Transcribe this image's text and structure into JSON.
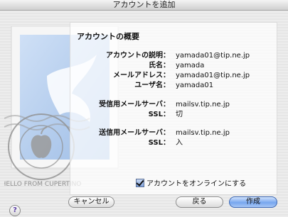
{
  "window": {
    "title": "アカウントを追加"
  },
  "summary": {
    "title": "アカウントの概要",
    "rows": [
      {
        "label": "アカウントの説明：",
        "value": "yamada01@tip.ne.jp"
      },
      {
        "label": "氏名：",
        "value": "yamada"
      },
      {
        "label": "メールアドレス：",
        "value": "yamada01@tip.ne.jp"
      },
      {
        "label": "ユーザ名：",
        "value": "yamada01"
      },
      {
        "label": "受信用メールサーバ：",
        "value": "mailsv.tip.ne.jp"
      },
      {
        "label": "SSL：",
        "value": "切"
      },
      {
        "label": "送信用メールサーバ：",
        "value": "mailsv.tip.ne.jp"
      },
      {
        "label": "SSL：",
        "value": "入"
      }
    ]
  },
  "online_checkbox": {
    "label": "アカウントをオンラインにする",
    "checked": true
  },
  "buttons": {
    "cancel": "キャンセル",
    "back": "戻る",
    "create": "作成",
    "help": "?"
  },
  "stamp": {
    "postmark_text": "HELLO FROM CUPERTINO"
  }
}
